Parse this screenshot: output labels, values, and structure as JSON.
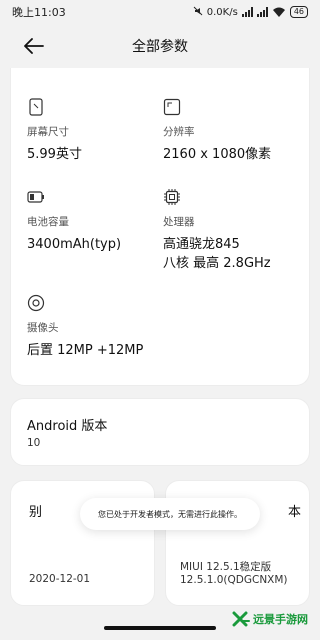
{
  "status_bar": {
    "time": "晚上11:03",
    "net_speed": "0.0K/s",
    "battery": "46"
  },
  "header": {
    "title": "全部参数"
  },
  "specs": [
    {
      "icon": "screen-size-icon",
      "label": "屏幕尺寸",
      "value": "5.99英寸"
    },
    {
      "icon": "resolution-icon",
      "label": "分辨率",
      "value": "2160 x 1080像素"
    },
    {
      "icon": "battery-icon",
      "label": "电池容量",
      "value": "3400mAh(typ)"
    },
    {
      "icon": "processor-icon",
      "label": "处理器",
      "value_line1": "高通骁龙845",
      "value_line2": "八核 最高 2.8GHz"
    },
    {
      "icon": "camera-icon",
      "label": "摄像头",
      "value": "后置 12MP +12MP"
    }
  ],
  "android_card": {
    "title": "Android 版本",
    "value": "10"
  },
  "date_card": {
    "partial_title": "别",
    "value": "2020-12-01"
  },
  "miui_card": {
    "partial_title": "本",
    "value_line1": "MIUI 12.5.1稳定版",
    "value_line2": "12.5.1.0(QDGCNXM)"
  },
  "toast": {
    "message": "您已处于开发者模式，无需进行此操作。"
  },
  "watermark": {
    "text": "远景手游网"
  },
  "colors": {
    "background": "#f2f2f2",
    "card": "#ffffff",
    "watermark_green": "#1a9a3c"
  }
}
